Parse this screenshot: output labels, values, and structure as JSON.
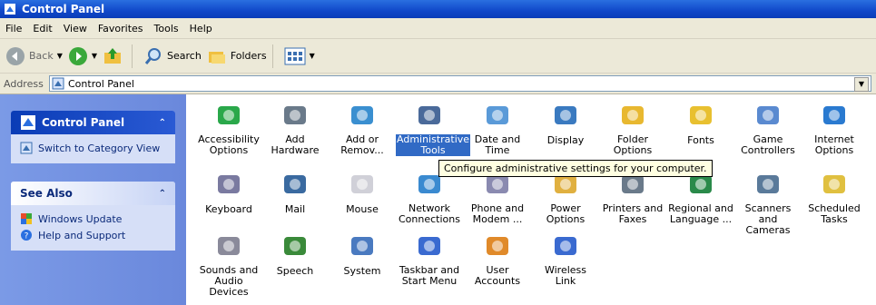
{
  "window": {
    "title": "Control Panel"
  },
  "menu": [
    "File",
    "Edit",
    "View",
    "Favorites",
    "Tools",
    "Help"
  ],
  "toolbar": {
    "back": "Back",
    "search": "Search",
    "folders": "Folders"
  },
  "address": {
    "label": "Address",
    "value": "Control Panel"
  },
  "sidebar": {
    "panel_title": "Control Panel",
    "switch_view": "Switch to Category View",
    "see_also_title": "See Also",
    "links": [
      "Windows Update",
      "Help and Support"
    ]
  },
  "items": [
    {
      "label": "Accessibility Options",
      "icon": "accessibility-icon"
    },
    {
      "label": "Add Hardware",
      "icon": "add-hardware-icon"
    },
    {
      "label": "Add or Remov...",
      "icon": "add-remove-programs-icon"
    },
    {
      "label": "Administrative Tools",
      "icon": "administrative-tools-icon",
      "selected": true
    },
    {
      "label": "Date and Time",
      "icon": "date-time-icon"
    },
    {
      "label": "Display",
      "icon": "display-icon"
    },
    {
      "label": "Folder Options",
      "icon": "folder-options-icon"
    },
    {
      "label": "Fonts",
      "icon": "fonts-icon"
    },
    {
      "label": "Game Controllers",
      "icon": "game-controllers-icon"
    },
    {
      "label": "Internet Options",
      "icon": "internet-options-icon"
    },
    {
      "label": "Keyboard",
      "icon": "keyboard-icon"
    },
    {
      "label": "Mail",
      "icon": "mail-icon"
    },
    {
      "label": "Mouse",
      "icon": "mouse-icon"
    },
    {
      "label": "Network Connections",
      "icon": "network-connections-icon"
    },
    {
      "label": "Phone and Modem ...",
      "icon": "phone-modem-icon"
    },
    {
      "label": "Power Options",
      "icon": "power-options-icon"
    },
    {
      "label": "Printers and Faxes",
      "icon": "printers-faxes-icon"
    },
    {
      "label": "Regional and Language ...",
      "icon": "regional-language-icon"
    },
    {
      "label": "Scanners and Cameras",
      "icon": "scanners-cameras-icon"
    },
    {
      "label": "Scheduled Tasks",
      "icon": "scheduled-tasks-icon"
    },
    {
      "label": "Sounds and Audio Devices",
      "icon": "sounds-audio-icon"
    },
    {
      "label": "Speech",
      "icon": "speech-icon"
    },
    {
      "label": "System",
      "icon": "system-icon"
    },
    {
      "label": "Taskbar and Start Menu",
      "icon": "taskbar-start-menu-icon"
    },
    {
      "label": "User Accounts",
      "icon": "user-accounts-icon"
    },
    {
      "label": "Wireless Link",
      "icon": "wireless-link-icon"
    }
  ],
  "tooltip": "Configure administrative settings for your computer."
}
